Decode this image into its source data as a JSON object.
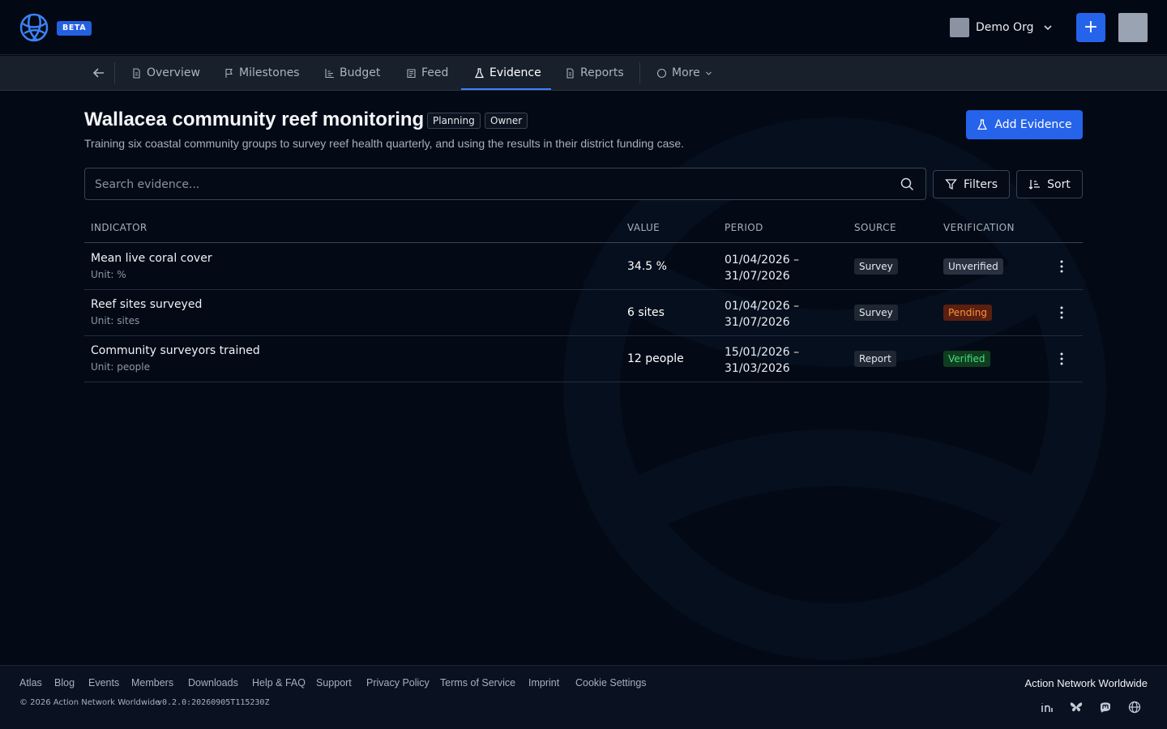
{
  "header": {
    "beta_label": "BETA",
    "org_name": "Demo Org",
    "plus_label": "+"
  },
  "tabs": [
    {
      "label": "Overview",
      "icon": "document-icon"
    },
    {
      "label": "Milestones",
      "icon": "flag-icon"
    },
    {
      "label": "Budget",
      "icon": "bar-chart-icon"
    },
    {
      "label": "Feed",
      "icon": "newspaper-icon"
    },
    {
      "label": "Evidence",
      "icon": "flask-icon",
      "active": true
    },
    {
      "label": "Reports",
      "icon": "report-icon"
    },
    {
      "label": "More",
      "icon": "circle-icon"
    }
  ],
  "project": {
    "title": "Wallacea community reef monitoring",
    "status_chip": "Planning",
    "role_chip": "Owner",
    "description": "Training six coastal community groups to survey reef health quarterly, and using the results in their district funding case.",
    "add_button": "Add Evidence"
  },
  "search": {
    "placeholder": "Search evidence...",
    "value": ""
  },
  "toolbar": {
    "filters_label": "Filters",
    "sort_label": "Sort"
  },
  "table": {
    "headers": {
      "indicator": "INDICATOR",
      "value": "VALUE",
      "period": "PERIOD",
      "source": "SOURCE",
      "verification": "VERIFICATION"
    },
    "rows": [
      {
        "indicator": "Mean live coral cover",
        "unit": "Unit: %",
        "value": "34.5 %",
        "period_start": "01/04/2026 –",
        "period_end": "31/07/2026",
        "source": "Survey",
        "verification": "Unverified"
      },
      {
        "indicator": "Reef sites surveyed",
        "unit": "Unit: sites",
        "value": "6 sites",
        "period_start": "01/04/2026 –",
        "period_end": "31/07/2026",
        "source": "Survey",
        "verification": "Pending"
      },
      {
        "indicator": "Community surveyors trained",
        "unit": "Unit: people",
        "value": "12 people",
        "period_start": "15/01/2026 –",
        "period_end": "31/03/2026",
        "source": "Report",
        "verification": "Verified"
      }
    ]
  },
  "footer": {
    "links": [
      "Atlas",
      "Blog",
      "Events",
      "Members",
      "Downloads",
      "Help & FAQ",
      "Support",
      "Privacy Policy",
      "Terms of Service",
      "Imprint",
      "Cookie Settings"
    ],
    "copyright": "© 2026 Action Network Worldwide",
    "version": "v0.2.0:20260905T115230Z",
    "brand": "Action Network Worldwide",
    "social_icons": [
      "linkedin-icon",
      "bluesky-icon",
      "mastodon-icon",
      "globe-icon"
    ]
  },
  "colors": {
    "accent": "#2563eb",
    "background": "#030a16",
    "unverified_badge": "#2a3140",
    "pending_badge": "#5a1f10",
    "verified_badge": "#0f3d1f"
  }
}
